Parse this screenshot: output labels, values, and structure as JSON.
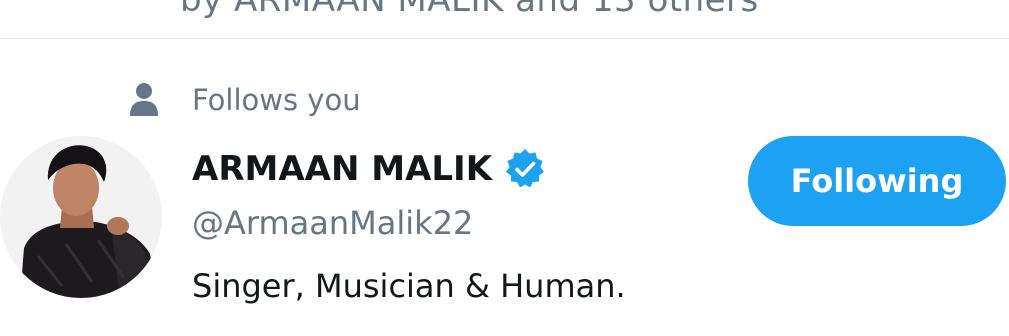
{
  "context_line": "by ARMAAN MALIK and 13 others",
  "follows": {
    "icon": "person-icon",
    "label": "Follows you"
  },
  "user": {
    "name": "ARMAAN MALIK",
    "verified_icon": "verified-badge-icon",
    "handle": "@ArmaanMalik22",
    "bio": "Singer, Musician & Human."
  },
  "follow_button": {
    "label": "Following"
  },
  "colors": {
    "accent": "#1da1f2",
    "secondary_text": "#657786",
    "primary_text": "#14171a",
    "divider": "#e1e8ed"
  }
}
